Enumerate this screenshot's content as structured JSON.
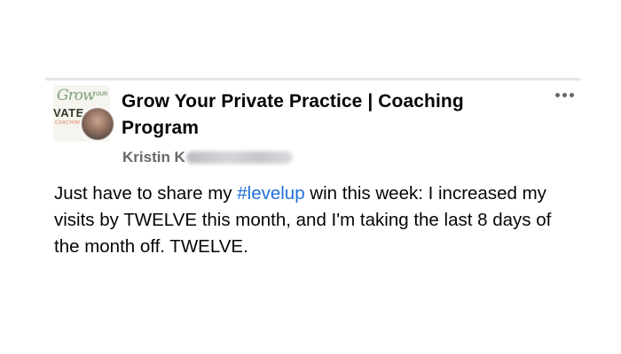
{
  "post": {
    "group_name": "Grow Your Private Practice | Coaching Program",
    "group_logo": {
      "script_text": "Grow",
      "small_text": "YOUR",
      "block_text": "VATE",
      "sub_text": "COACHING"
    },
    "author_name": "Kristin K",
    "more_options_icon": "ellipsis-horizontal-icon",
    "body": {
      "before_hashtag": "Just have to share my ",
      "hashtag": "#levelup",
      "after_hashtag": " win this week:  I increased my visits by TWELVE this month, and I'm taking the last 8 days of the month off. TWELVE."
    }
  },
  "colors": {
    "text_primary": "#050505",
    "text_secondary": "#65676b",
    "hashtag_link": "#216fdb",
    "divider": "#e4e6eb"
  }
}
